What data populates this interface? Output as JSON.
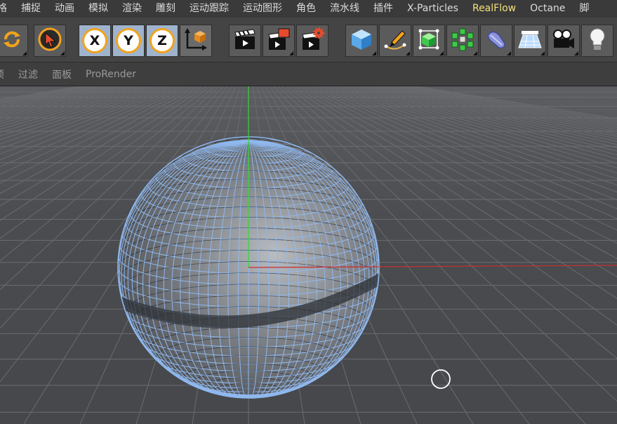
{
  "menubar": {
    "items": [
      {
        "label": "格",
        "highlight": false
      },
      {
        "label": "捕捉",
        "highlight": false
      },
      {
        "label": "动画",
        "highlight": false
      },
      {
        "label": "模拟",
        "highlight": false
      },
      {
        "label": "渲染",
        "highlight": false
      },
      {
        "label": "雕刻",
        "highlight": false
      },
      {
        "label": "运动跟踪",
        "highlight": false
      },
      {
        "label": "运动图形",
        "highlight": false
      },
      {
        "label": "角色",
        "highlight": false
      },
      {
        "label": "流水线",
        "highlight": false
      },
      {
        "label": "插件",
        "highlight": false
      },
      {
        "label": "X-Particles",
        "highlight": false
      },
      {
        "label": "RealFlow",
        "highlight": true
      },
      {
        "label": "Octane",
        "highlight": false
      },
      {
        "label": "脚",
        "highlight": false
      }
    ]
  },
  "toolbar": {
    "axis_x": "X",
    "axis_y": "Y",
    "axis_z": "Z",
    "icons": {
      "rotate": "rotate-icon",
      "select": "cursor-select-icon",
      "coord": "coordinate-system-icon",
      "render_view": "render-view-icon",
      "render_region": "render-region-icon",
      "render_settings": "render-settings-icon",
      "cube": "cube-icon",
      "pen": "spline-pen-icon",
      "subdivide": "subdivision-icon",
      "cloner": "cloner-icon",
      "deformer": "deformer-icon",
      "floor": "floor-icon",
      "camera": "camera-icon",
      "light": "light-icon"
    }
  },
  "subbar": {
    "items": [
      "项",
      "过滤",
      "面板",
      "ProRender"
    ]
  },
  "viewport": {
    "object": "sphere",
    "colors": {
      "wire": "#8fb8ee",
      "y_axis": "#38d63a",
      "x_axis": "#c83030",
      "grid": "#6a6c70"
    }
  }
}
